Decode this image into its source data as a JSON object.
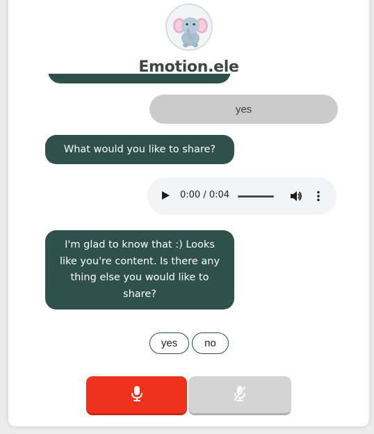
{
  "app": {
    "title": "Emotion.ele",
    "logo_icon": "elephant-icon"
  },
  "messages": {
    "user_reply": "yes",
    "bot_question": "What would you like to share?",
    "audio": {
      "time": "0:00 / 0:04",
      "play_icon": "play-icon",
      "volume_icon": "volume-icon",
      "more_icon": "more-vertical-icon"
    },
    "bot_response": "I'm glad to know that :) Looks like you're content. Is there any thing else you would like to share?"
  },
  "quick_replies": {
    "yes": "yes",
    "no": "no"
  },
  "controls": {
    "record_icon": "microphone-icon",
    "mute_icon": "microphone-off-icon"
  },
  "colors": {
    "bot_bubble": "#2e514e",
    "user_bubble": "#cbcbcb",
    "record_button": "#ee321c",
    "mute_button": "#d4d4d4"
  }
}
